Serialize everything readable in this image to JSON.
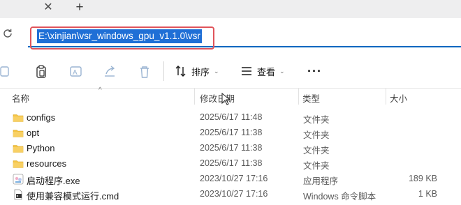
{
  "tabbar": {
    "close_icon": "close-icon",
    "new_tab_icon": "plus-icon"
  },
  "address": {
    "path": "E:\\xinjian\\vsr_windows_gpu_v1.1.0\\vsr",
    "refresh_icon": "refresh-icon"
  },
  "toolbar": {
    "icons": [
      "copy-icon",
      "paste-icon",
      "rename-icon",
      "share-icon",
      "delete-icon"
    ],
    "sort_label": "排序",
    "view_label": "查看",
    "more_icon": "more-icon"
  },
  "columns": {
    "name": "名称",
    "date": "修改日期",
    "type": "类型",
    "size": "大小"
  },
  "files": [
    {
      "icon": "folder-icon",
      "name": "configs",
      "date": "2025/6/17 11:48",
      "type": "文件夹",
      "size": ""
    },
    {
      "icon": "folder-icon",
      "name": "opt",
      "date": "2025/6/17 11:38",
      "type": "文件夹",
      "size": ""
    },
    {
      "icon": "folder-icon",
      "name": "Python",
      "date": "2025/6/17 11:38",
      "type": "文件夹",
      "size": ""
    },
    {
      "icon": "folder-icon",
      "name": "resources",
      "date": "2025/6/17 11:38",
      "type": "文件夹",
      "size": ""
    },
    {
      "icon": "app-icon",
      "name": "启动程序.exe",
      "date": "2023/10/27 17:16",
      "type": "应用程序",
      "size": "189 KB"
    },
    {
      "icon": "script-icon",
      "name": "使用兼容模式运行.cmd",
      "date": "2023/10/27 17:16",
      "type": "Windows 命令脚本",
      "size": "1 KB"
    }
  ],
  "colors": {
    "accent": "#0067c0",
    "highlight_box": "#e0545b",
    "selection": "#1f6fd6",
    "folder": "#f5c443"
  }
}
